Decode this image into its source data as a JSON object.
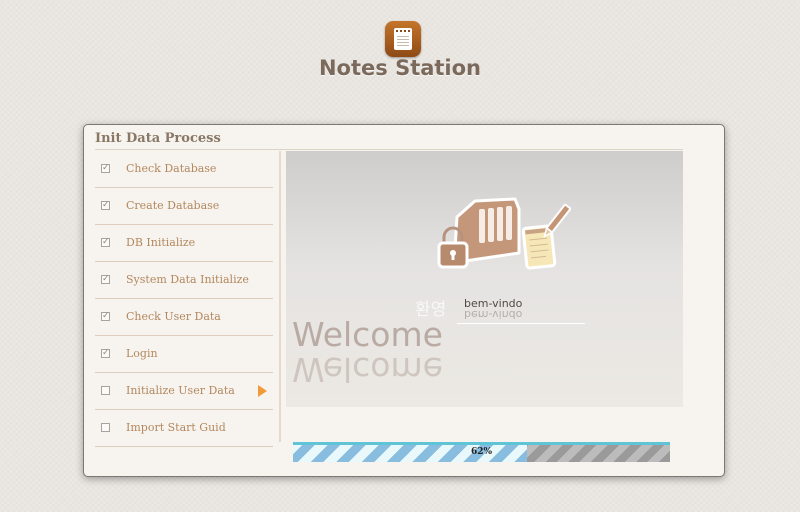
{
  "app": {
    "title": "Notes Station",
    "logo_icon": "notebook-icon",
    "accent_color": "#b3885f"
  },
  "dialog": {
    "title": "Init Data Process",
    "steps": [
      {
        "label": "Check Database",
        "checked": true
      },
      {
        "label": "Create Database",
        "checked": true
      },
      {
        "label": "DB Initialize",
        "checked": true
      },
      {
        "label": "System Data Initialize",
        "checked": true
      },
      {
        "label": "Check User Data",
        "checked": true
      },
      {
        "label": "Login",
        "checked": true
      },
      {
        "label": "Initialize User Data",
        "checked": false,
        "current": true
      },
      {
        "label": "Import Start Guid",
        "checked": false
      }
    ],
    "current_step_indicator": "orange-arrow-icon",
    "welcome": {
      "korean": "환영",
      "portuguese": "bem-vindo",
      "main": "Welcome",
      "illustration_icon": "nas-notes-illustration-icon"
    },
    "progress": {
      "percent": 62,
      "label": "62%",
      "fill_color": "#89bde0",
      "track_color": "#a2a2a2"
    }
  }
}
